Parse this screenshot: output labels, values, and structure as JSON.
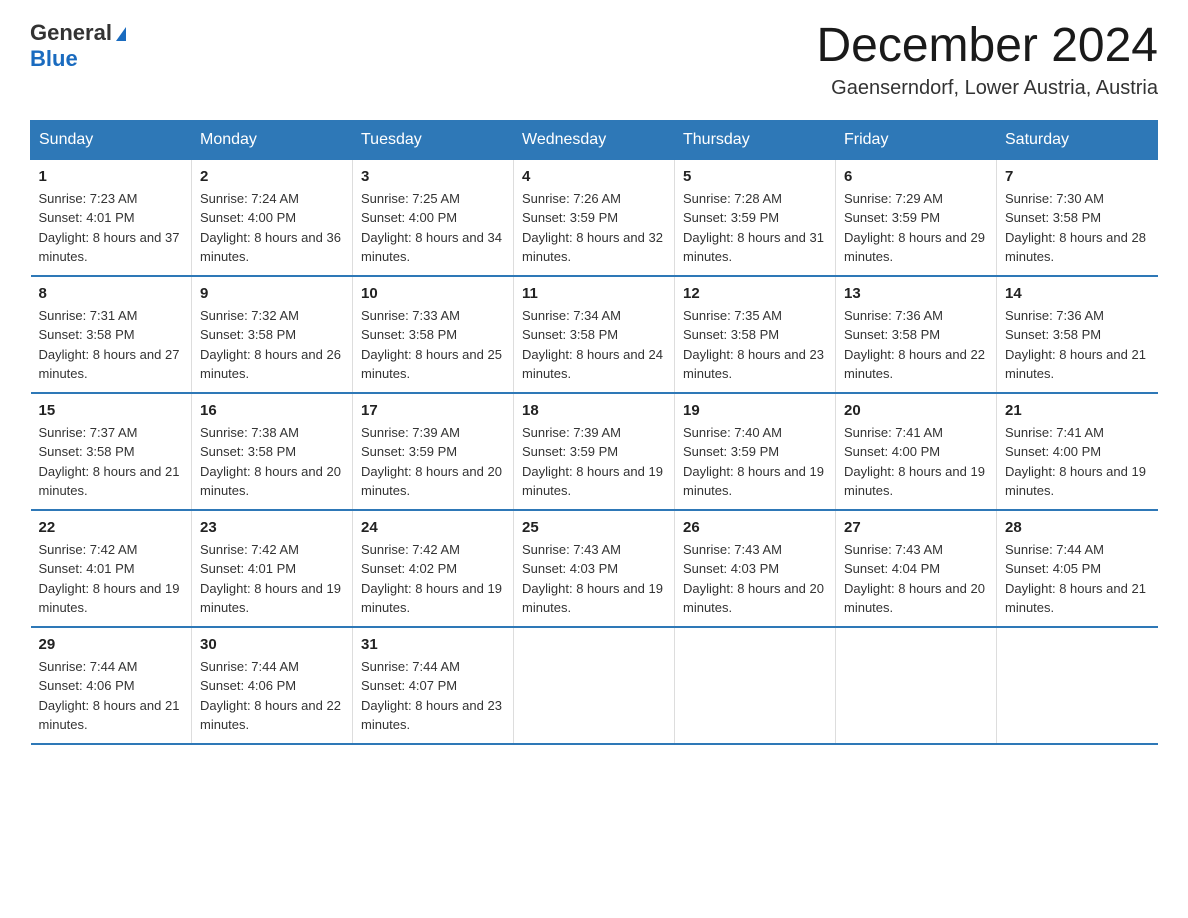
{
  "header": {
    "logo_general": "General",
    "logo_blue": "Blue",
    "title": "December 2024",
    "subtitle": "Gaenserndorf, Lower Austria, Austria"
  },
  "weekdays": [
    "Sunday",
    "Monday",
    "Tuesday",
    "Wednesday",
    "Thursday",
    "Friday",
    "Saturday"
  ],
  "weeks": [
    [
      {
        "day": "1",
        "sunrise": "7:23 AM",
        "sunset": "4:01 PM",
        "daylight": "8 hours and 37 minutes."
      },
      {
        "day": "2",
        "sunrise": "7:24 AM",
        "sunset": "4:00 PM",
        "daylight": "8 hours and 36 minutes."
      },
      {
        "day": "3",
        "sunrise": "7:25 AM",
        "sunset": "4:00 PM",
        "daylight": "8 hours and 34 minutes."
      },
      {
        "day": "4",
        "sunrise": "7:26 AM",
        "sunset": "3:59 PM",
        "daylight": "8 hours and 32 minutes."
      },
      {
        "day": "5",
        "sunrise": "7:28 AM",
        "sunset": "3:59 PM",
        "daylight": "8 hours and 31 minutes."
      },
      {
        "day": "6",
        "sunrise": "7:29 AM",
        "sunset": "3:59 PM",
        "daylight": "8 hours and 29 minutes."
      },
      {
        "day": "7",
        "sunrise": "7:30 AM",
        "sunset": "3:58 PM",
        "daylight": "8 hours and 28 minutes."
      }
    ],
    [
      {
        "day": "8",
        "sunrise": "7:31 AM",
        "sunset": "3:58 PM",
        "daylight": "8 hours and 27 minutes."
      },
      {
        "day": "9",
        "sunrise": "7:32 AM",
        "sunset": "3:58 PM",
        "daylight": "8 hours and 26 minutes."
      },
      {
        "day": "10",
        "sunrise": "7:33 AM",
        "sunset": "3:58 PM",
        "daylight": "8 hours and 25 minutes."
      },
      {
        "day": "11",
        "sunrise": "7:34 AM",
        "sunset": "3:58 PM",
        "daylight": "8 hours and 24 minutes."
      },
      {
        "day": "12",
        "sunrise": "7:35 AM",
        "sunset": "3:58 PM",
        "daylight": "8 hours and 23 minutes."
      },
      {
        "day": "13",
        "sunrise": "7:36 AM",
        "sunset": "3:58 PM",
        "daylight": "8 hours and 22 minutes."
      },
      {
        "day": "14",
        "sunrise": "7:36 AM",
        "sunset": "3:58 PM",
        "daylight": "8 hours and 21 minutes."
      }
    ],
    [
      {
        "day": "15",
        "sunrise": "7:37 AM",
        "sunset": "3:58 PM",
        "daylight": "8 hours and 21 minutes."
      },
      {
        "day": "16",
        "sunrise": "7:38 AM",
        "sunset": "3:58 PM",
        "daylight": "8 hours and 20 minutes."
      },
      {
        "day": "17",
        "sunrise": "7:39 AM",
        "sunset": "3:59 PM",
        "daylight": "8 hours and 20 minutes."
      },
      {
        "day": "18",
        "sunrise": "7:39 AM",
        "sunset": "3:59 PM",
        "daylight": "8 hours and 19 minutes."
      },
      {
        "day": "19",
        "sunrise": "7:40 AM",
        "sunset": "3:59 PM",
        "daylight": "8 hours and 19 minutes."
      },
      {
        "day": "20",
        "sunrise": "7:41 AM",
        "sunset": "4:00 PM",
        "daylight": "8 hours and 19 minutes."
      },
      {
        "day": "21",
        "sunrise": "7:41 AM",
        "sunset": "4:00 PM",
        "daylight": "8 hours and 19 minutes."
      }
    ],
    [
      {
        "day": "22",
        "sunrise": "7:42 AM",
        "sunset": "4:01 PM",
        "daylight": "8 hours and 19 minutes."
      },
      {
        "day": "23",
        "sunrise": "7:42 AM",
        "sunset": "4:01 PM",
        "daylight": "8 hours and 19 minutes."
      },
      {
        "day": "24",
        "sunrise": "7:42 AM",
        "sunset": "4:02 PM",
        "daylight": "8 hours and 19 minutes."
      },
      {
        "day": "25",
        "sunrise": "7:43 AM",
        "sunset": "4:03 PM",
        "daylight": "8 hours and 19 minutes."
      },
      {
        "day": "26",
        "sunrise": "7:43 AM",
        "sunset": "4:03 PM",
        "daylight": "8 hours and 20 minutes."
      },
      {
        "day": "27",
        "sunrise": "7:43 AM",
        "sunset": "4:04 PM",
        "daylight": "8 hours and 20 minutes."
      },
      {
        "day": "28",
        "sunrise": "7:44 AM",
        "sunset": "4:05 PM",
        "daylight": "8 hours and 21 minutes."
      }
    ],
    [
      {
        "day": "29",
        "sunrise": "7:44 AM",
        "sunset": "4:06 PM",
        "daylight": "8 hours and 21 minutes."
      },
      {
        "day": "30",
        "sunrise": "7:44 AM",
        "sunset": "4:06 PM",
        "daylight": "8 hours and 22 minutes."
      },
      {
        "day": "31",
        "sunrise": "7:44 AM",
        "sunset": "4:07 PM",
        "daylight": "8 hours and 23 minutes."
      },
      null,
      null,
      null,
      null
    ]
  ]
}
